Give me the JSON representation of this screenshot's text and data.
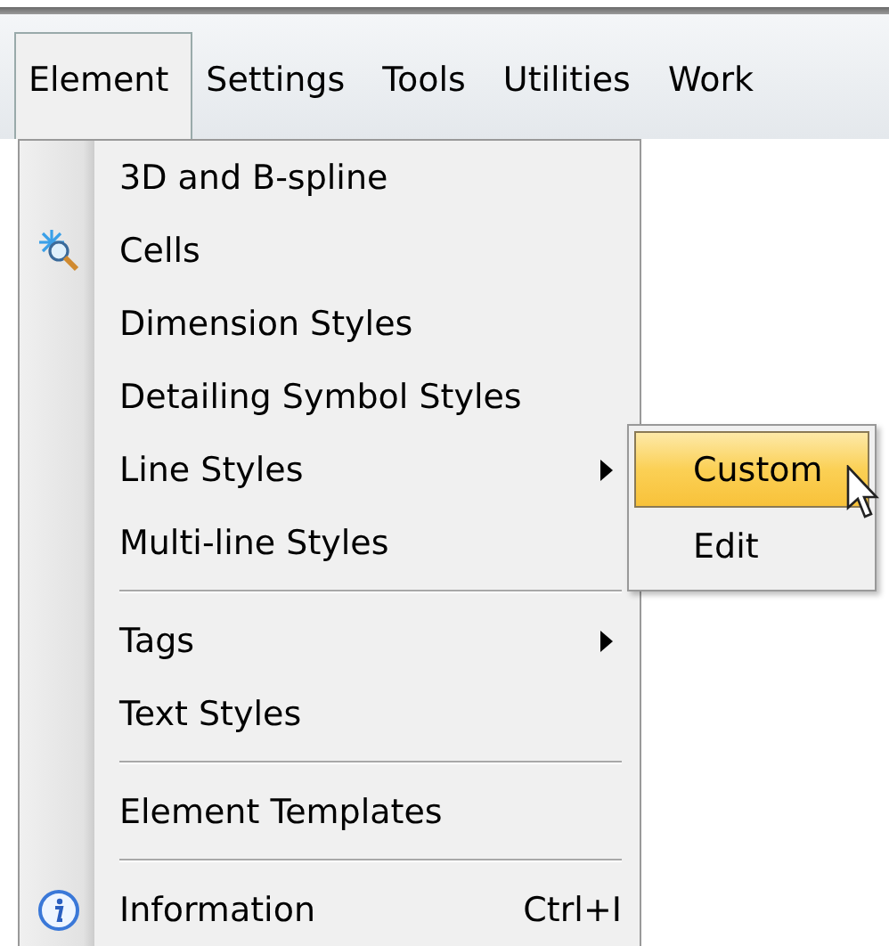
{
  "menubar": [
    {
      "label": "Element",
      "selected": true
    },
    {
      "label": "Settings",
      "selected": false
    },
    {
      "label": "Tools",
      "selected": false
    },
    {
      "label": "Utilities",
      "selected": false
    },
    {
      "label": "Work",
      "selected": false
    }
  ],
  "menu": {
    "items": [
      {
        "kind": "item",
        "label": "3D and B-spline",
        "submenu": false
      },
      {
        "kind": "item",
        "label": "Cells",
        "submenu": false
      },
      {
        "kind": "item",
        "label": "Dimension Styles",
        "submenu": false
      },
      {
        "kind": "item",
        "label": "Detailing Symbol Styles",
        "submenu": false
      },
      {
        "kind": "item",
        "label": "Line Styles",
        "submenu": true
      },
      {
        "kind": "item",
        "label": "Multi-line Styles",
        "submenu": false
      },
      {
        "kind": "separator"
      },
      {
        "kind": "item",
        "label": "Tags",
        "submenu": true
      },
      {
        "kind": "item",
        "label": "Text Styles",
        "submenu": false
      },
      {
        "kind": "separator"
      },
      {
        "kind": "item",
        "label": "Element Templates",
        "submenu": false
      },
      {
        "kind": "separator"
      },
      {
        "kind": "item",
        "label": "Information",
        "shortcut": "Ctrl+I",
        "submenu": false
      }
    ]
  },
  "submenu": {
    "items": [
      {
        "label": "Custom",
        "selected": true
      },
      {
        "label": "Edit",
        "selected": false
      }
    ]
  }
}
